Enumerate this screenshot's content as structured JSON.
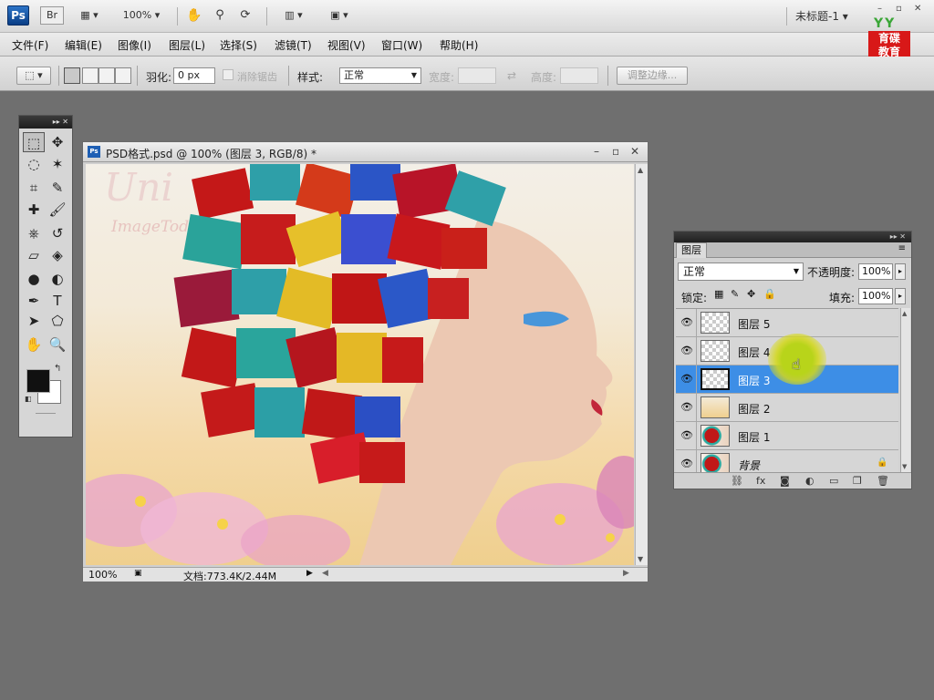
{
  "appbar": {
    "logo": "Ps",
    "bridge": "Br",
    "zoom": "100%",
    "doc_tab": "未标题-1",
    "window_controls": [
      "–",
      "▫",
      "✕"
    ],
    "brand_logo": {
      "top": "YY",
      "line1": "育碟",
      "line2": "教育"
    }
  },
  "menu": {
    "items": [
      "文件(F)",
      "编辑(E)",
      "图像(I)",
      "图层(L)",
      "选择(S)",
      "滤镜(T)",
      "视图(V)",
      "窗口(W)",
      "帮助(H)"
    ]
  },
  "options": {
    "feather_label": "羽化:",
    "feather_value": "0 px",
    "antialias_label": "消除锯齿",
    "style_label": "样式:",
    "style_value": "正常",
    "width_label": "宽度:",
    "height_label": "高度:",
    "refine_edge_button": "调整边缘..."
  },
  "tools": {
    "icons": [
      "marquee-icon",
      "move-icon",
      "lasso-icon",
      "magic-wand-icon",
      "crop-icon",
      "eyedropper-icon",
      "healing-icon",
      "brush-icon",
      "clone-stamp-icon",
      "history-brush-icon",
      "eraser-icon",
      "paint-bucket-icon",
      "blur-icon",
      "dodge-icon",
      "pen-icon",
      "type-icon",
      "path-select-icon",
      "shape-icon",
      "hand-icon",
      "zoom-icon"
    ],
    "glyphs": [
      "⬚",
      "✥",
      "◌",
      "✶",
      "⌗",
      "✎",
      "✚",
      "🖌",
      "⎈",
      "↺",
      "▱",
      "◈",
      "●",
      "◐",
      "✒",
      "T",
      "➤",
      "⬠",
      "✋",
      "🔍"
    ],
    "foreground_color": "#111111",
    "background_color": "#ffffff"
  },
  "document": {
    "title": "PSD格式.psd @ 100% (图层 3, RGB/8) *",
    "zoom": "100%",
    "doc_info": "文档:773.4K/2.44M"
  },
  "layers_panel": {
    "tab": "图层",
    "blend_mode": "正常",
    "opacity_label": "不透明度:",
    "opacity_value": "100%",
    "lock_label": "锁定:",
    "fill_label": "填充:",
    "fill_value": "100%",
    "layers": [
      {
        "name": "图层 5",
        "thumb": "transparent",
        "selected": false
      },
      {
        "name": "图层 4",
        "thumb": "transparent",
        "selected": false
      },
      {
        "name": "图层 3",
        "thumb": "transparent",
        "selected": true
      },
      {
        "name": "图层 2",
        "thumb": "beige",
        "selected": false
      },
      {
        "name": "图层 1",
        "thumb": "image",
        "selected": false
      },
      {
        "name": "背景",
        "thumb": "image",
        "selected": false,
        "locked": true
      }
    ],
    "footer_icons": [
      "link-icon",
      "fx-icon",
      "mask-icon",
      "adjustment-icon",
      "group-icon",
      "new-layer-icon",
      "trash-icon"
    ],
    "footer_glyphs": [
      "⛓",
      "fx",
      "◙",
      "◐",
      "▭",
      "❐",
      "🗑"
    ]
  },
  "colors": {
    "selection": "#3d8ee6",
    "panel_head": "#2b2b2b",
    "workspace": "#6f6f6f"
  }
}
